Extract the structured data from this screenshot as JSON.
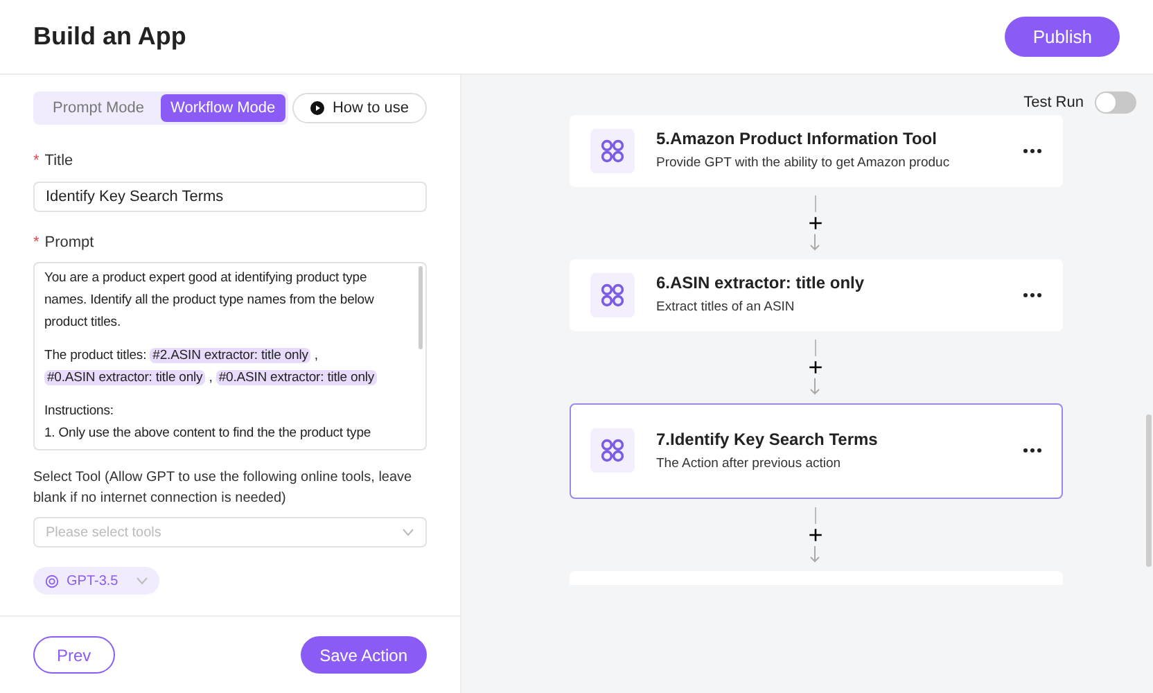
{
  "header": {
    "title": "Build an App",
    "publish": "Publish"
  },
  "modes": [
    {
      "label": "Prompt Mode",
      "selected": false
    },
    {
      "label": "Workflow Mode",
      "selected": true
    }
  ],
  "how_to_use": "How to use",
  "required_mark": "*",
  "title_field": {
    "label": "Title",
    "required": true,
    "value": "Identify Key Search Terms"
  },
  "prompt_field": {
    "label": "Prompt",
    "required": true,
    "paragraphs": [
      [
        {
          "kind": "text",
          "text": "You are a product expert good at identifying product type names. Identify all the product type names from the below product titles."
        }
      ],
      [
        {
          "kind": "text",
          "text": "The product titles: "
        },
        {
          "kind": "chip",
          "text": "#2.ASIN extractor: title only"
        },
        {
          "kind": "text",
          "text": " , "
        },
        {
          "kind": "chip",
          "text": "#0.ASIN extractor: title only"
        },
        {
          "kind": "text",
          "text": " , "
        },
        {
          "kind": "chip",
          "text": "#0.ASIN extractor: title only"
        }
      ],
      [
        {
          "kind": "text",
          "text": "Instructions:"
        }
      ],
      [
        {
          "kind": "text",
          "text": "1. Only use the above content to find the the product type"
        }
      ]
    ]
  },
  "tool_field": {
    "label": "Select Tool (Allow GPT to use the following online tools, leave blank if no internet connection is needed)",
    "placeholder": "Please select tools"
  },
  "model": "GPT-3.5",
  "footer": {
    "prev": "Prev",
    "save": "Save Action"
  },
  "test_run": {
    "label": "Test Run",
    "on": false
  },
  "steps": [
    {
      "title": "5.Amazon Product Information Tool",
      "description": "Provide GPT with the ability to get Amazon produc",
      "selected": false
    },
    {
      "title": "6.ASIN extractor: title only",
      "description": "Extract titles of an ASIN",
      "selected": false
    },
    {
      "title": "7.Identify Key Search Terms",
      "description": "The Action after previous action",
      "selected": true
    }
  ],
  "connector_symbol": "+"
}
